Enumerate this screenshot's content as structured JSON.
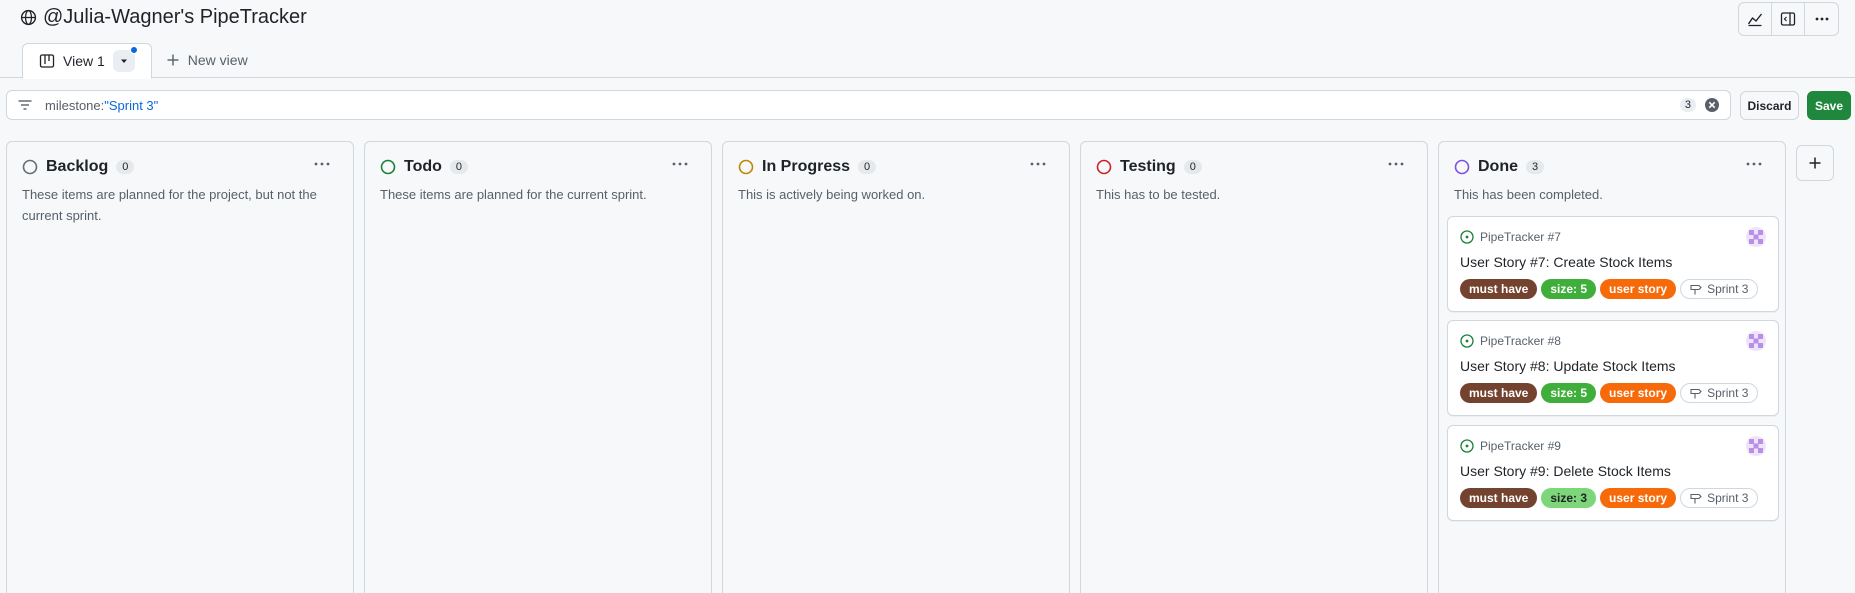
{
  "header": {
    "title": "@Julia-Wagner's PipeTracker",
    "actions": [
      "insights-icon",
      "panel-icon",
      "more-icon"
    ]
  },
  "tabs": {
    "active_label": "View 1",
    "new_view_label": "New view"
  },
  "filter": {
    "prefix": "milestone:",
    "value": "\"Sprint 3\"",
    "count": "3",
    "discard_label": "Discard",
    "save_label": "Save"
  },
  "columns": [
    {
      "name": "Backlog",
      "count": "0",
      "description": "These items are planned for the project, but not the current sprint.",
      "color": "#656d76"
    },
    {
      "name": "Todo",
      "count": "0",
      "description": "These items are planned for the current sprint.",
      "color": "#1a7f37"
    },
    {
      "name": "In Progress",
      "count": "0",
      "description": "This is actively being worked on.",
      "color": "#bf8700"
    },
    {
      "name": "Testing",
      "count": "0",
      "description": "This has to be tested.",
      "color": "#cf222e"
    },
    {
      "name": "Done",
      "count": "3",
      "description": "This has been completed.",
      "color": "#8250df"
    }
  ],
  "cards": [
    {
      "repo": "PipeTracker #7",
      "title": "User Story #7: Create Stock Items",
      "labels": [
        {
          "text": "must have",
          "bg": "#74432f",
          "fg": "#ffffff"
        },
        {
          "text": "size: 5",
          "bg": "#3fae3a",
          "fg": "#ffffff"
        },
        {
          "text": "user story",
          "bg": "#f66a0a",
          "fg": "#ffffff"
        }
      ],
      "milestone": "Sprint 3"
    },
    {
      "repo": "PipeTracker #8",
      "title": "User Story #8: Update Stock Items",
      "labels": [
        {
          "text": "must have",
          "bg": "#74432f",
          "fg": "#ffffff"
        },
        {
          "text": "size: 5",
          "bg": "#3fae3a",
          "fg": "#ffffff"
        },
        {
          "text": "user story",
          "bg": "#f66a0a",
          "fg": "#ffffff"
        }
      ],
      "milestone": "Sprint 3"
    },
    {
      "repo": "PipeTracker #9",
      "title": "User Story #9: Delete Stock Items",
      "labels": [
        {
          "text": "must have",
          "bg": "#74432f",
          "fg": "#ffffff"
        },
        {
          "text": "size: 3",
          "bg": "#7ed67a",
          "fg": "#1f2328"
        },
        {
          "text": "user story",
          "bg": "#f66a0a",
          "fg": "#ffffff"
        }
      ],
      "milestone": "Sprint 3"
    }
  ]
}
